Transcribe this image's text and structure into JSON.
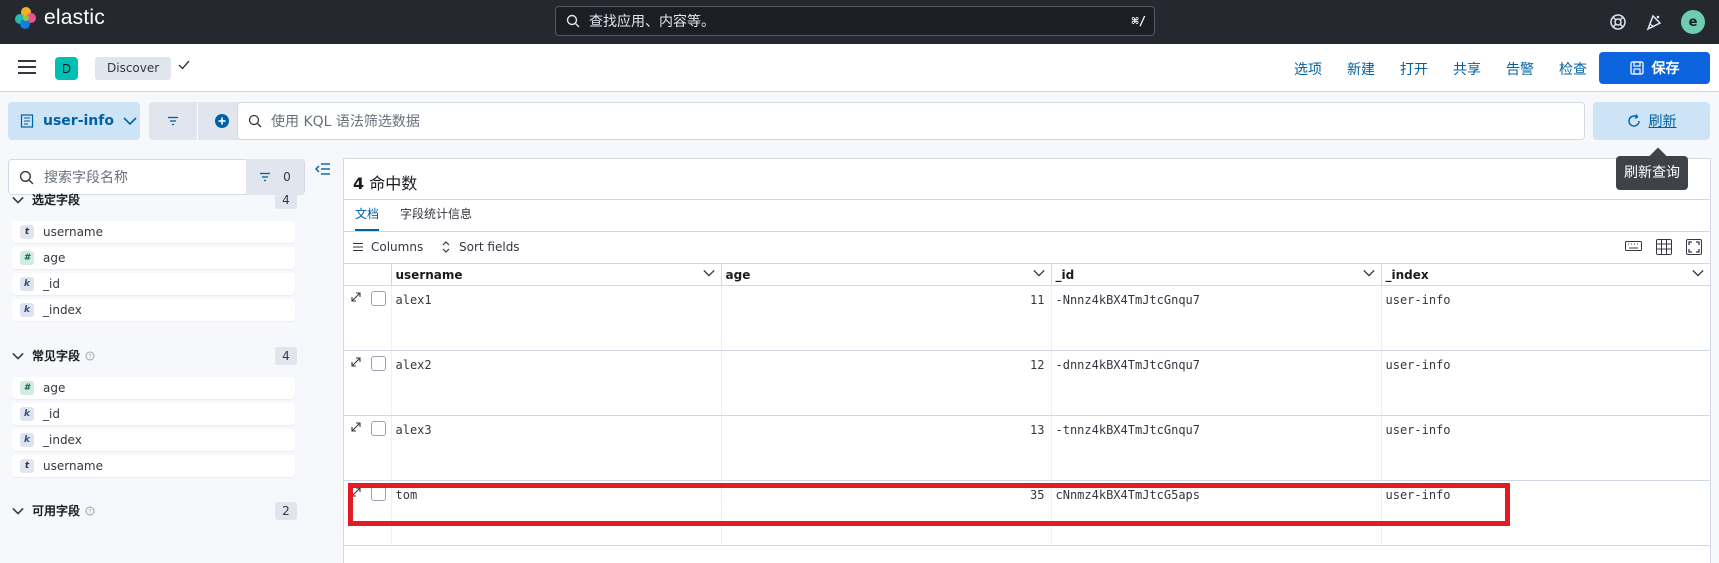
{
  "topbar": {
    "logo_text": "elastic",
    "search_placeholder": "查找应用、内容等。",
    "search_shortcut": "⌘/",
    "avatar_letter": "e"
  },
  "appbar": {
    "space_letter": "D",
    "breadcrumb": "Discover",
    "menu": [
      "选项",
      "新建",
      "打开",
      "共享",
      "告警",
      "检查"
    ],
    "save_label": "保存"
  },
  "querybar": {
    "data_view": "user-info",
    "kql_placeholder": "使用 KQL 语法筛选数据",
    "refresh_label": "刷新",
    "refresh_tooltip": "刷新查询"
  },
  "sidebar": {
    "search_placeholder": "搜索字段名称",
    "filter_count": "0",
    "sections": [
      {
        "title": "选定字段",
        "count": "4",
        "fields": [
          {
            "type": "t",
            "name": "username"
          },
          {
            "type": "#",
            "name": "age"
          },
          {
            "type": "k",
            "name": "_id"
          },
          {
            "type": "k",
            "name": "_index"
          }
        ]
      },
      {
        "title": "常见字段",
        "count": "4",
        "fields": [
          {
            "type": "#",
            "name": "age"
          },
          {
            "type": "k",
            "name": "_id"
          },
          {
            "type": "k",
            "name": "_index"
          },
          {
            "type": "t",
            "name": "username"
          }
        ]
      },
      {
        "title": "可用字段",
        "count": "2",
        "fields": []
      }
    ]
  },
  "main": {
    "hits_count": "4",
    "hits_label": "命中数",
    "tabs": [
      "文档",
      "字段统计信息"
    ],
    "columns_label": "Columns",
    "sort_label": "Sort fields",
    "columns": [
      "username",
      "age",
      "_id",
      "_index"
    ],
    "rows": [
      [
        "alex1",
        "11",
        "-Nnnz4kBX4TmJtcGnqu7",
        "user-info"
      ],
      [
        "alex2",
        "12",
        "-dnnz4kBX4TmJtcGnqu7",
        "user-info"
      ],
      [
        "alex3",
        "13",
        "-tnnz4kBX4TmJtcGnqu7",
        "user-info"
      ],
      [
        "tom",
        "35",
        "cNnmz4kBX4TmJtcG5aps",
        "user-info"
      ]
    ]
  },
  "colors": {
    "topbar_bg": "#25282f",
    "primary": "#0b64dd",
    "link": "#0061a6",
    "highlight_box": "#e31b23"
  }
}
